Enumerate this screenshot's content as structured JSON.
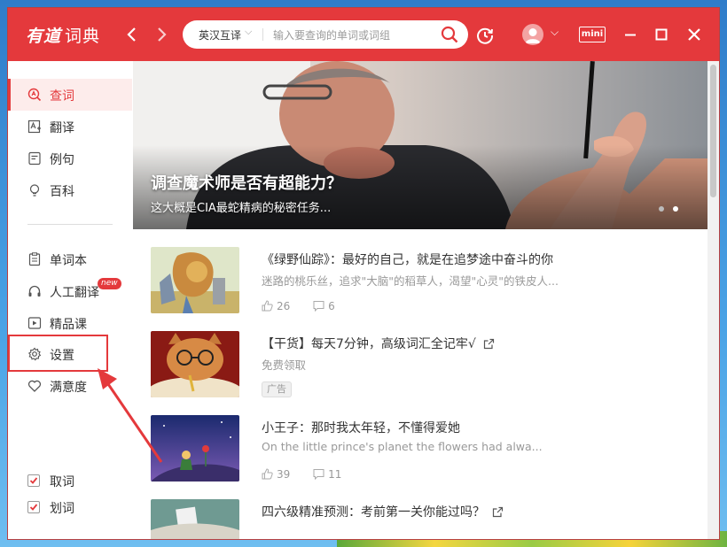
{
  "app": {
    "logo": "有道",
    "logo_sub": "词典"
  },
  "search": {
    "lang": "英汉互译",
    "placeholder": "输入要查询的单词或词组"
  },
  "titlebar": {
    "mini_label": "mini"
  },
  "sidebar": {
    "items": [
      {
        "label": "查词",
        "icon": "search-word-icon",
        "active": true
      },
      {
        "label": "翻译",
        "icon": "translate-icon"
      },
      {
        "label": "例句",
        "icon": "example-icon"
      },
      {
        "label": "百科",
        "icon": "bulb-icon"
      },
      {
        "label": "单词本",
        "icon": "wordbook-icon"
      },
      {
        "label": "人工翻译",
        "icon": "headset-icon",
        "badge": "new"
      },
      {
        "label": "精品课",
        "icon": "course-icon"
      },
      {
        "label": "设置",
        "icon": "gear-icon"
      },
      {
        "label": "满意度",
        "icon": "heart-icon"
      }
    ],
    "checks": [
      {
        "label": "取词",
        "checked": true
      },
      {
        "label": "划词",
        "checked": true
      }
    ]
  },
  "banner": {
    "title": "调查魔术师是否有超能力？",
    "subtitle": "这大概是CIA最蛇精病的秘密任务..."
  },
  "feed": [
    {
      "title": "《绿野仙踪》：最好的自己，就是在追梦途中奋斗的你",
      "desc": "迷路的桃乐丝，追求\"大脑\"的稻草人，渴望\"心灵\"的铁皮人...",
      "likes": "26",
      "comments": "6"
    },
    {
      "title": "【干货】每天7分钟，高级词汇全记牢√",
      "desc": "免费领取",
      "ad": "广告"
    },
    {
      "title": "小王子：那时我太年轻，不懂得爱她",
      "desc": "On the little prince's planet the flowers had alwa...",
      "likes": "39",
      "comments": "11"
    },
    {
      "title": "四六级精准预测：考前第一关你能过吗？"
    }
  ],
  "colors": {
    "accent": "#e4393c"
  }
}
